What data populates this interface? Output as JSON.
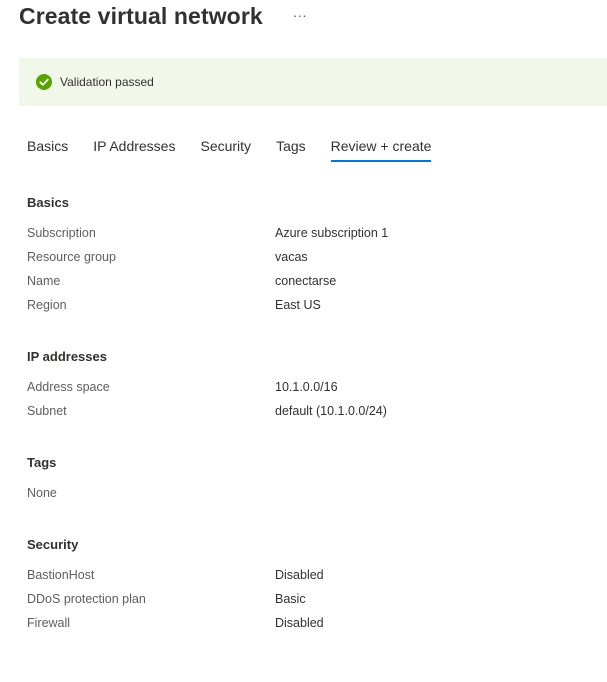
{
  "header": {
    "title": "Create virtual network",
    "more_label": "···"
  },
  "validation": {
    "text": "Validation passed",
    "icon": "check-circle-icon",
    "color": "#57a300",
    "background": "#f1f8ea"
  },
  "tabs": [
    {
      "label": "Basics",
      "active": false
    },
    {
      "label": "IP Addresses",
      "active": false
    },
    {
      "label": "Security",
      "active": false
    },
    {
      "label": "Tags",
      "active": false
    },
    {
      "label": "Review + create",
      "active": true
    }
  ],
  "accent_color": "#0078d4",
  "sections": {
    "basics": {
      "title": "Basics",
      "rows": [
        {
          "key": "Subscription",
          "value": "Azure subscription 1"
        },
        {
          "key": "Resource group",
          "value": "vacas"
        },
        {
          "key": "Name",
          "value": "conectarse"
        },
        {
          "key": "Region",
          "value": "East US"
        }
      ]
    },
    "ip": {
      "title": "IP addresses",
      "rows": [
        {
          "key": "Address space",
          "value": "10.1.0.0/16"
        },
        {
          "key": "Subnet",
          "value": "default (10.1.0.0/24)"
        }
      ]
    },
    "tags": {
      "title": "Tags",
      "value": "None"
    },
    "security": {
      "title": "Security",
      "rows": [
        {
          "key": "BastionHost",
          "value": "Disabled"
        },
        {
          "key": "DDoS protection plan",
          "value": "Basic"
        },
        {
          "key": "Firewall",
          "value": "Disabled"
        }
      ]
    }
  }
}
